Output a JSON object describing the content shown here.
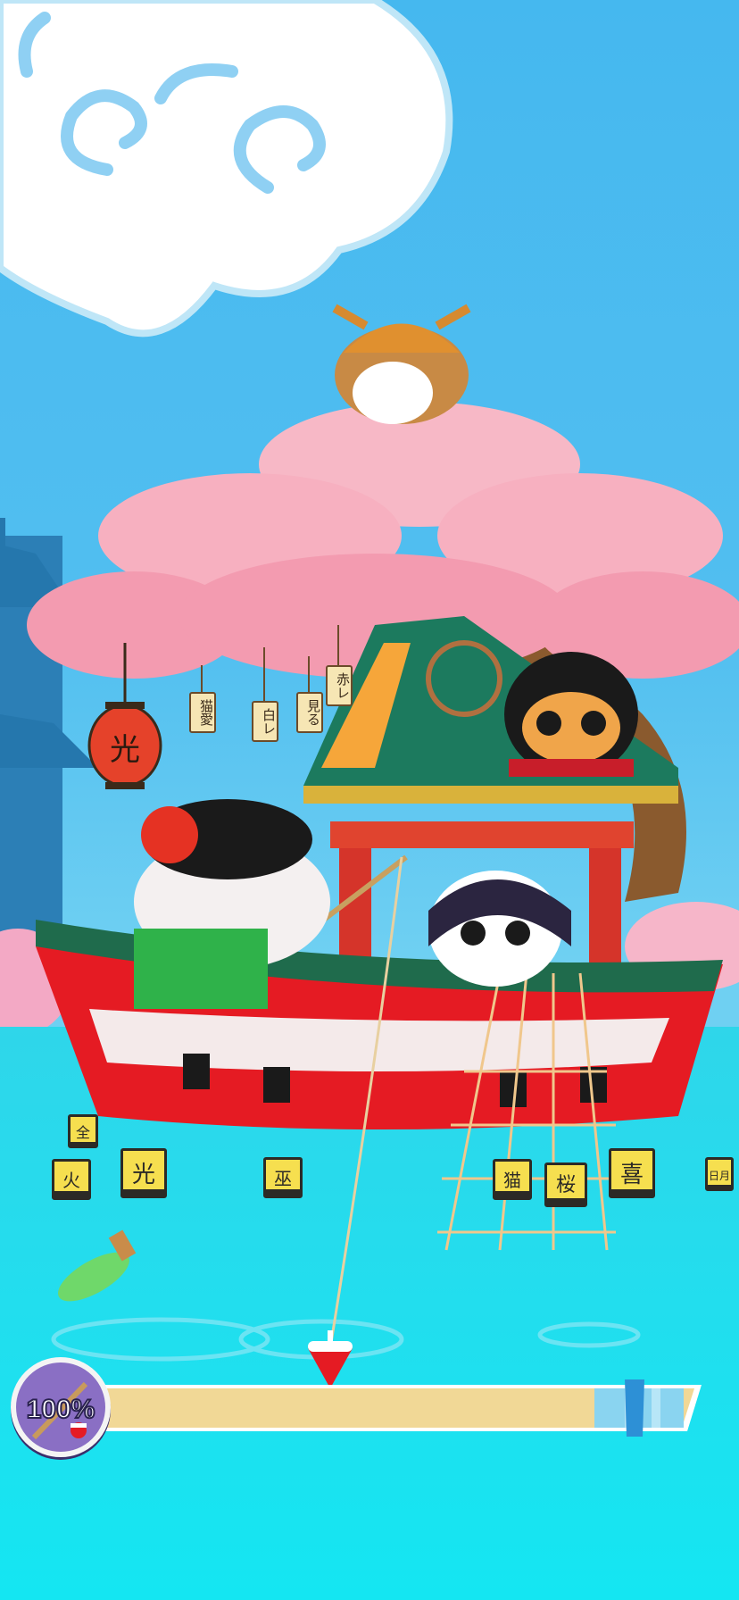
{
  "game": {
    "lantern_label": "光",
    "hanging_tags": [
      "猫愛",
      "白レ",
      "見る",
      "赤レ"
    ],
    "water_floats": [
      "全",
      "火",
      "光",
      "巫",
      "猫",
      "桜",
      "喜",
      "日月"
    ],
    "power_meter": {
      "label": "100%",
      "percent": 100
    }
  },
  "colors": {
    "sky": "#45b8ef",
    "water": "#2fe0ef",
    "blossom": "#f7a8bb",
    "boat_red": "#e51b23",
    "meter_fill": "#f1d896",
    "badge": "#8a6fc4"
  }
}
